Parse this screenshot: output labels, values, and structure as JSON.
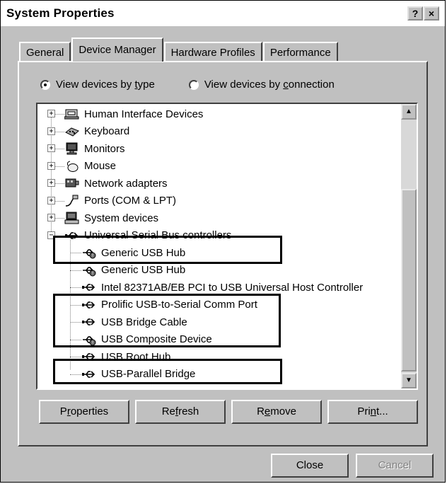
{
  "window": {
    "title": "System Properties",
    "help_label": "?",
    "close_label": "×"
  },
  "tabs": [
    {
      "label": "General"
    },
    {
      "label": "Device Manager",
      "active": true
    },
    {
      "label": "Hardware Profiles"
    },
    {
      "label": "Performance"
    }
  ],
  "view_options": {
    "by_type": {
      "label_prefix": "View devices by ",
      "accel": "t",
      "label_suffix": "ype",
      "selected": true
    },
    "by_connection": {
      "label_prefix": "View devices by ",
      "accel": "c",
      "label_suffix": "onnection",
      "selected": false
    }
  },
  "tree": {
    "categories": [
      {
        "label": "Human Interface Devices",
        "icon": "hid-icon",
        "expander": "+"
      },
      {
        "label": "Keyboard",
        "icon": "keyboard-icon",
        "expander": "+"
      },
      {
        "label": "Monitors",
        "icon": "monitor-icon",
        "expander": "+"
      },
      {
        "label": "Mouse",
        "icon": "mouse-icon",
        "expander": "+"
      },
      {
        "label": "Network adapters",
        "icon": "network-adapter-icon",
        "expander": "+"
      },
      {
        "label": "Ports (COM & LPT)",
        "icon": "port-icon",
        "expander": "+"
      },
      {
        "label": "System devices",
        "icon": "system-device-icon",
        "expander": "+"
      },
      {
        "label": "Universal Serial Bus controllers",
        "icon": "usb-icon",
        "expander": "−"
      }
    ],
    "usb_children": [
      {
        "label": "Generic USB Hub",
        "icon": "usb-warning-icon"
      },
      {
        "label": "Generic USB Hub",
        "icon": "usb-warning-icon"
      },
      {
        "label": "Intel 82371AB/EB PCI to USB Universal Host Controller",
        "icon": "usb-icon"
      },
      {
        "label": "Prolific USB-to-Serial Comm Port",
        "icon": "usb-icon"
      },
      {
        "label": "USB Bridge Cable",
        "icon": "usb-icon"
      },
      {
        "label": "USB Composite Device",
        "icon": "usb-warning-icon"
      },
      {
        "label": "USB Root Hub",
        "icon": "usb-icon"
      },
      {
        "label": "USB-Parallel Bridge",
        "icon": "usb-icon"
      }
    ]
  },
  "scrollbar": {
    "up": "▲",
    "down": "▼"
  },
  "actions": {
    "properties": {
      "pre": "P",
      "accel": "r",
      "post": "operties"
    },
    "refresh": {
      "pre": "Re",
      "accel": "f",
      "post": "resh"
    },
    "remove": {
      "pre": "R",
      "accel": "e",
      "post": "move"
    },
    "print": {
      "pre": "Pri",
      "accel": "n",
      "post": "t..."
    }
  },
  "dialog": {
    "close_label": "Close",
    "cancel_label": "Cancel"
  }
}
